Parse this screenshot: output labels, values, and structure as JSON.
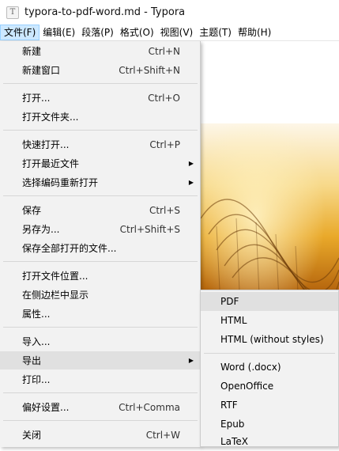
{
  "window": {
    "title": "typora-to-pdf-word.md - Typora",
    "icon": "T"
  },
  "menubar": [
    {
      "label": "文件(F)",
      "active": true
    },
    {
      "label": "编辑(E)"
    },
    {
      "label": "段落(P)"
    },
    {
      "label": "格式(O)"
    },
    {
      "label": "视图(V)"
    },
    {
      "label": "主题(T)"
    },
    {
      "label": "帮助(H)"
    }
  ],
  "file_menu": [
    {
      "label": "新建",
      "shortcut": "Ctrl+N"
    },
    {
      "label": "新建窗口",
      "shortcut": "Ctrl+Shift+N"
    },
    {
      "label": "打开...",
      "shortcut": "Ctrl+O"
    },
    {
      "label": "打开文件夹...",
      "shortcut": ""
    },
    {
      "label": "快速打开...",
      "shortcut": "Ctrl+P"
    },
    {
      "label": "打开最近文件",
      "shortcut": ""
    },
    {
      "label": "选择编码重新打开",
      "shortcut": ""
    },
    {
      "label": "保存",
      "shortcut": "Ctrl+S"
    },
    {
      "label": "另存为...",
      "shortcut": "Ctrl+Shift+S"
    },
    {
      "label": "保存全部打开的文件...",
      "shortcut": ""
    },
    {
      "label": "打开文件位置...",
      "shortcut": ""
    },
    {
      "label": "在侧边栏中显示",
      "shortcut": ""
    },
    {
      "label": "属性...",
      "shortcut": ""
    },
    {
      "label": "导入...",
      "shortcut": ""
    },
    {
      "label": "导出",
      "shortcut": ""
    },
    {
      "label": "打印...",
      "shortcut": ""
    },
    {
      "label": "偏好设置...",
      "shortcut": "Ctrl+Comma"
    },
    {
      "label": "关闭",
      "shortcut": "Ctrl+W"
    }
  ],
  "export_menu": [
    {
      "label": "PDF"
    },
    {
      "label": "HTML"
    },
    {
      "label": "HTML (without styles)"
    },
    {
      "label": "Word (.docx)"
    },
    {
      "label": "OpenOffice"
    },
    {
      "label": "RTF"
    },
    {
      "label": "Epub"
    },
    {
      "label": "LaTeX"
    }
  ],
  "colors": {
    "hover": "#e0e0e0",
    "menu_bg": "#f2f2f2",
    "active_menu": "#cce8ff"
  }
}
